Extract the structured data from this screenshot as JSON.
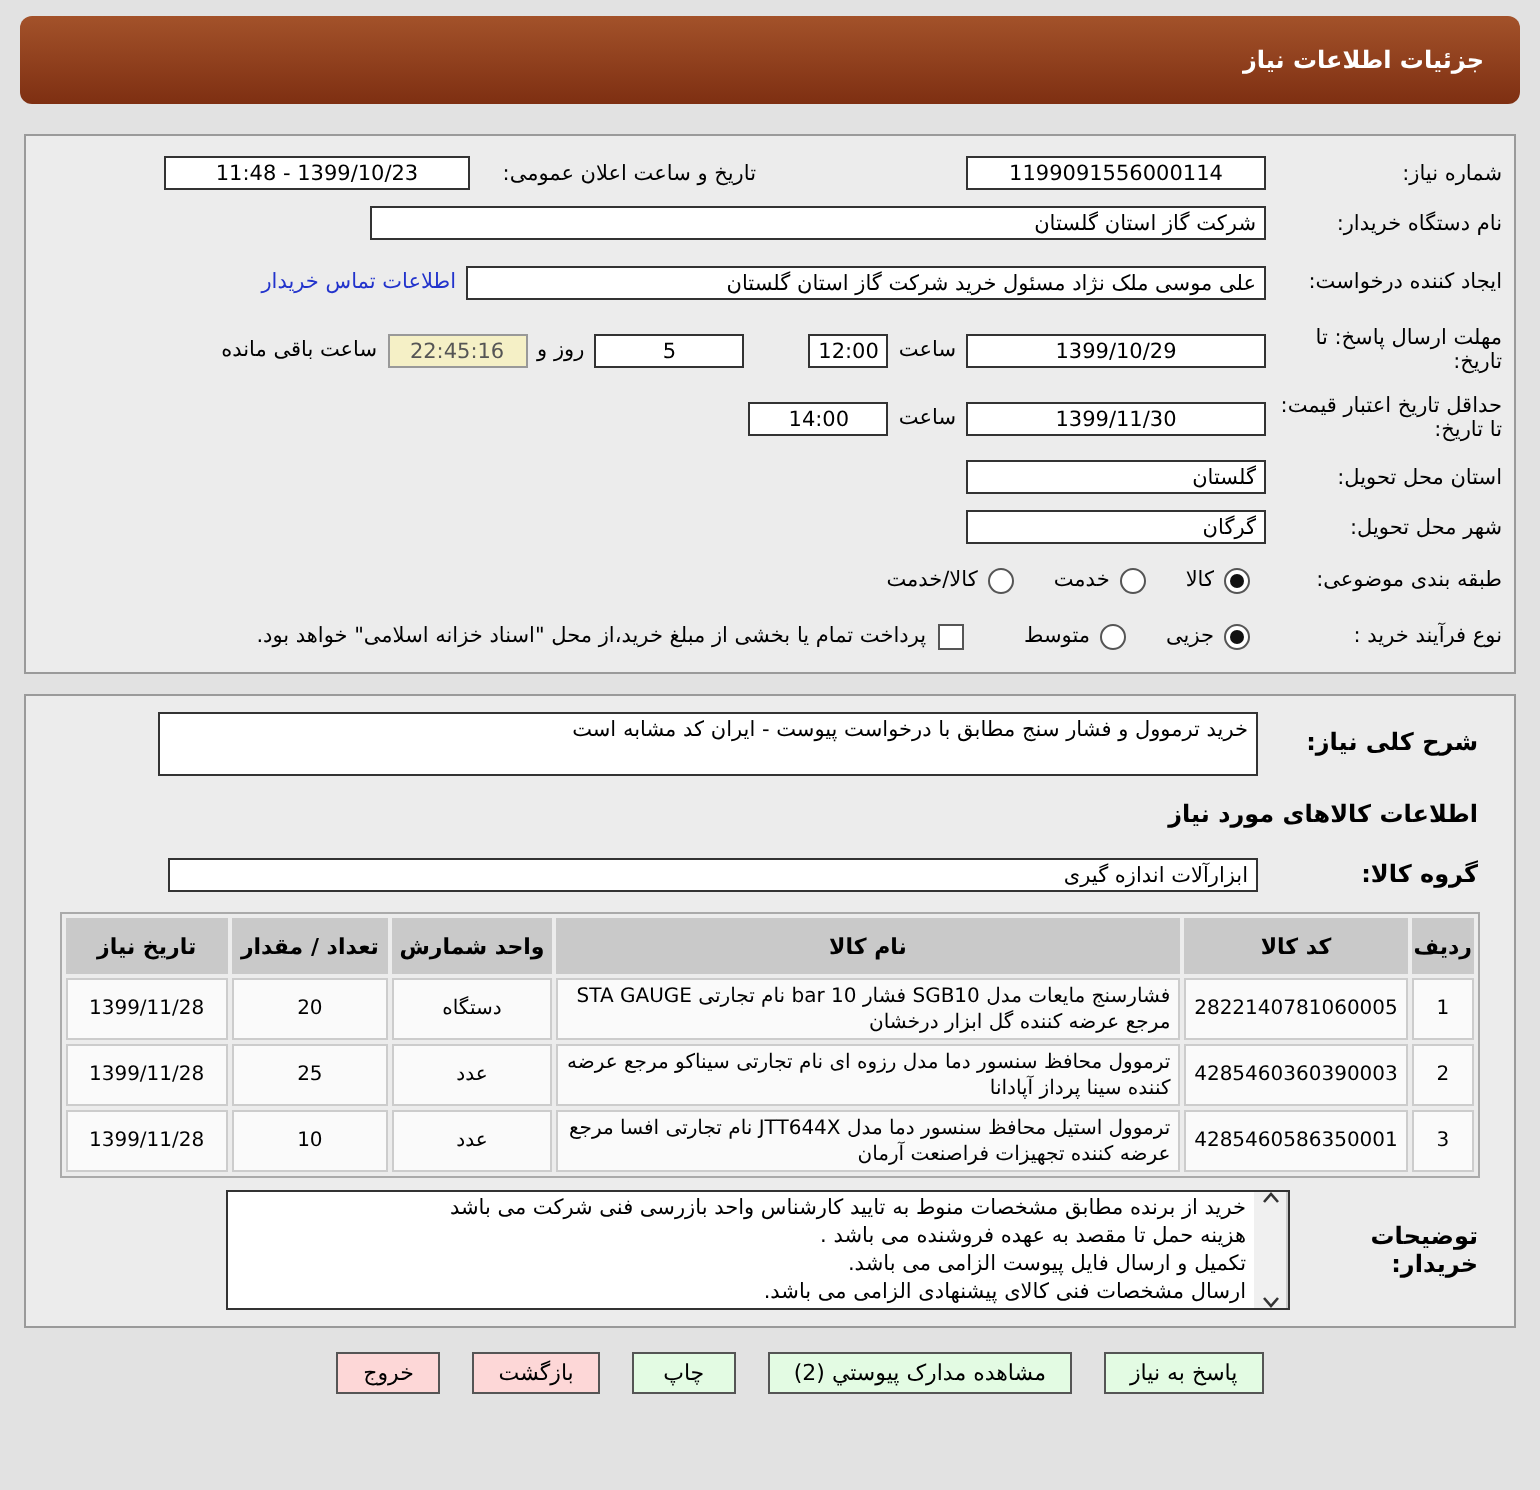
{
  "header": {
    "title": "جزئیات اطلاعات نیاز"
  },
  "fields": {
    "need_number": {
      "label": "شماره نیاز:",
      "value": "1199091556000114"
    },
    "announce": {
      "label": "تاریخ و ساعت اعلان عمومی:",
      "value": "1399/10/23 - 11:48"
    },
    "buyer_org": {
      "label": "نام دستگاه خریدار:",
      "value": "شرکت گاز استان گلستان"
    },
    "requester": {
      "label": "ایجاد کننده درخواست:",
      "value": "علی موسی ملک نژاد مسئول خرید شرکت گاز استان گلستان",
      "link": "اطلاعات تماس خریدار"
    },
    "deadline": {
      "label": "مهلت ارسال پاسخ: تا تاریخ:",
      "date": "1399/10/29",
      "time_label": "ساعت",
      "time": "12:00",
      "days": "5",
      "days_label": "روز و",
      "remaining": "22:45:16",
      "remaining_label": "ساعت باقی مانده"
    },
    "validity": {
      "label": "حداقل تاریخ اعتبار قیمت: تا تاریخ:",
      "date": "1399/11/30",
      "time_label": "ساعت",
      "time": "14:00"
    },
    "province": {
      "label": "استان محل تحویل:",
      "value": "گلستان"
    },
    "city": {
      "label": "شهر محل تحویل:",
      "value": "گرگان"
    },
    "category": {
      "label": "طبقه بندی موضوعی:",
      "options": [
        {
          "label": "کالا",
          "selected": true
        },
        {
          "label": "خدمت",
          "selected": false
        },
        {
          "label": "کالا/خدمت",
          "selected": false
        }
      ]
    },
    "process": {
      "label": "نوع فرآیند خرید :",
      "options": [
        {
          "label": "جزیی",
          "selected": true
        },
        {
          "label": "متوسط",
          "selected": false
        }
      ],
      "payment": {
        "checked": false,
        "text": "پرداخت تمام یا بخشی از مبلغ خرید،از محل \"اسناد خزانه اسلامی\" خواهد بود."
      }
    }
  },
  "description": {
    "label": "شرح کلی نیاز:",
    "value": "خرید ترموول  و فشار سنج مطابق با درخواست پیوست - ایران کد مشابه است"
  },
  "goods_heading": "اطلاعات کالاهای مورد نیاز",
  "group": {
    "label": "گروه کالا:",
    "value": "ابزارآلات اندازه گیری"
  },
  "table": {
    "columns": [
      "ردیف",
      "کد کالا",
      "نام کالا",
      "واحد شمارش",
      "تعداد / مقدار",
      "تاریخ نیاز"
    ],
    "rows": [
      {
        "row": "1",
        "code": "2822140781060005",
        "name": "فشارسنج مایعات مدل SGB10 فشار 10 bar نام تجارتی STA GAUGE مرجع عرضه کننده گل ابزار درخشان",
        "unit": "دستگاه",
        "qty": "20",
        "date": "1399/11/28"
      },
      {
        "row": "2",
        "code": "4285460360390003",
        "name": "ترموول محافظ سنسور دما مدل رزوه ای نام تجارتی سیناکو مرجع عرضه کننده سینا پرداز آپادانا",
        "unit": "عدد",
        "qty": "25",
        "date": "1399/11/28"
      },
      {
        "row": "3",
        "code": "4285460586350001",
        "name": "ترموول استیل محافظ سنسور دما مدل JTT644X نام تجارتی افسا مرجع عرضه کننده تجهیزات فراصنعت آرمان",
        "unit": "عدد",
        "qty": "10",
        "date": "1399/11/28"
      }
    ]
  },
  "notes": {
    "label": "توضیحات خریدار:",
    "lines": [
      "خرید از برنده مطابق مشخصات منوط به تایید کارشناس واحد بازرسی فنی شرکت می باشد",
      "هزینه حمل تا مقصد به عهده فروشنده می باشد .",
      "تکمیل و ارسال فایل پیوست الزامی می باشد.",
      "ارسال مشخصات فنی کالای پیشنهادی الزامی می باشد."
    ]
  },
  "buttons": [
    {
      "label": "پاسخ به نیاز",
      "kind": "go"
    },
    {
      "label": "مشاهده مدارک پیوستي (2)",
      "kind": "go"
    },
    {
      "label": "چاپ",
      "kind": "go"
    },
    {
      "label": "بازگشت",
      "kind": "stop"
    },
    {
      "label": "خروج",
      "kind": "stop"
    }
  ]
}
